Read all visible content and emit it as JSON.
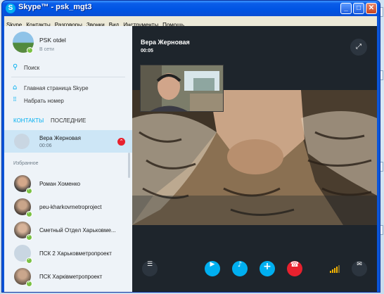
{
  "window": {
    "title": "Skype™ - psk_mgt3",
    "min_label": "_",
    "max_label": "□",
    "close_label": "✕",
    "logo_glyph": "S"
  },
  "menu": [
    "Skype",
    "Контакты",
    "Разговоры",
    "Звонки",
    "Вид",
    "Инструменты",
    "Помощь"
  ],
  "profile": {
    "name": "PSK otdel",
    "status": "В сети"
  },
  "nav": {
    "search": "Поиск",
    "home": "Главная страница Skype",
    "dial": "Набрать номер"
  },
  "tabs": {
    "contacts": "КОНТАКТЫ",
    "recent": "ПОСЛЕДНИЕ"
  },
  "active_call": {
    "name": "Вера Жерновая",
    "duration": "00:06"
  },
  "favorites_label": "Избранное",
  "contacts": [
    {
      "name": "Роман Хоменко"
    },
    {
      "name": "peu-kharkovmetroproject"
    },
    {
      "name": "Сметный Отдел Харьковме..."
    },
    {
      "name": "ПСК 2 Харьковметропроект"
    },
    {
      "name": "ПСК Харківметропроект"
    }
  ],
  "call_header": {
    "name": "Вера Жерновая",
    "timer": "00:05"
  },
  "icons": {
    "search": "search-icon",
    "home": "home-icon",
    "dialpad": "dialpad-icon",
    "expand": "expand-icon",
    "list": "participants-icon",
    "video": "video-icon",
    "mic": "microphone-icon",
    "add": "add-icon",
    "hangup": "hangup-icon",
    "signal": "signal-icon",
    "chat": "chat-icon"
  },
  "colors": {
    "skype_blue": "#00aff0",
    "hangup_red": "#e8212e",
    "online_green": "#7ac143",
    "call_bg": "#1e252c",
    "titlebar": "#0054e3"
  }
}
